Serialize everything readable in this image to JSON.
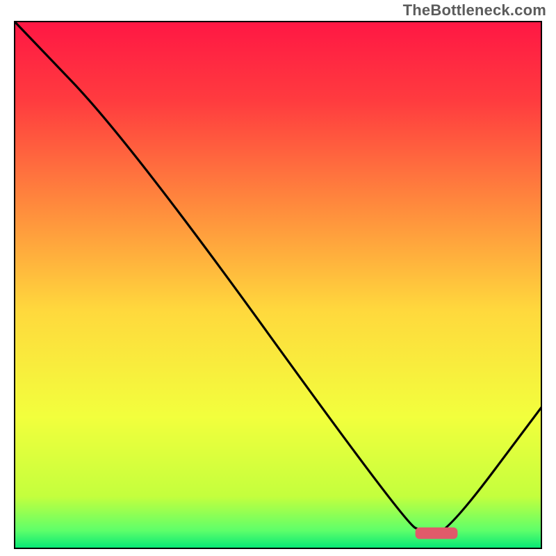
{
  "watermark": "TheBottleneck.com",
  "chart_data": {
    "type": "line",
    "title": "",
    "xlabel": "",
    "ylabel": "",
    "xlim": [
      0,
      100
    ],
    "ylim": [
      0,
      100
    ],
    "grid": false,
    "background": {
      "type": "vertical-gradient",
      "description": "Bottleneck severity gradient: green (optimal) at bottom through yellow/orange to red (severe bottleneck) at top",
      "stops": [
        {
          "offset": 0.0,
          "color": "#ff1744"
        },
        {
          "offset": 0.15,
          "color": "#ff3b3f"
        },
        {
          "offset": 0.35,
          "color": "#ff8a3d"
        },
        {
          "offset": 0.55,
          "color": "#ffd93d"
        },
        {
          "offset": 0.75,
          "color": "#f2ff3d"
        },
        {
          "offset": 0.9,
          "color": "#c4ff3d"
        },
        {
          "offset": 0.965,
          "color": "#5eff6a"
        },
        {
          "offset": 1.0,
          "color": "#00e676"
        }
      ]
    },
    "series": [
      {
        "name": "bottleneck-curve",
        "x": [
          0,
          22,
          74,
          78,
          82,
          100
        ],
        "y": [
          100,
          77,
          5,
          3,
          3,
          27
        ]
      }
    ],
    "marker": {
      "name": "optimal-range",
      "shape": "rounded-bar",
      "color": "#e05a6a",
      "x_center": 80,
      "y": 3,
      "width": 8,
      "height": 2.2
    }
  }
}
